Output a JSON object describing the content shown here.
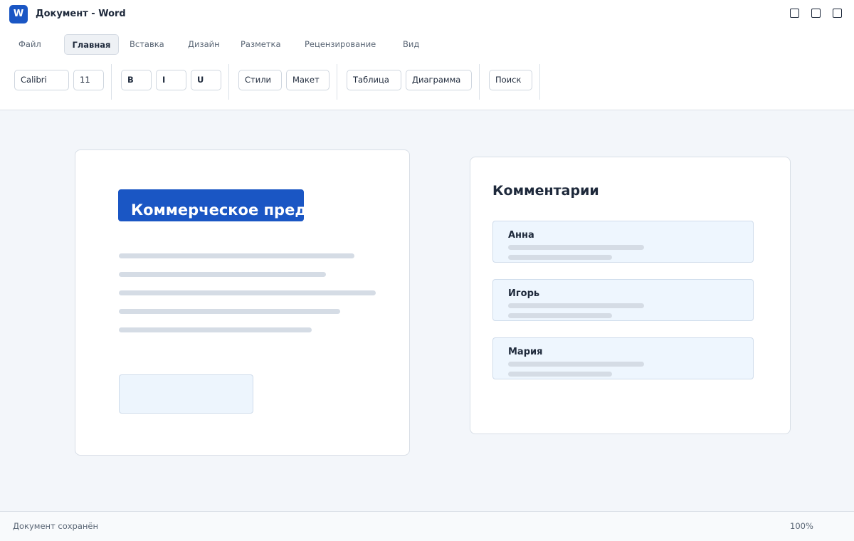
{
  "window": {
    "logo": "W",
    "title": "Документ - Word",
    "controls": [
      "minimize-icon",
      "maximize-icon",
      "close-icon"
    ]
  },
  "ribbon": {
    "tabs": [
      {
        "label": "Файл",
        "active": false
      },
      {
        "label": "Главная",
        "active": true
      },
      {
        "label": "Вставка",
        "active": false
      },
      {
        "label": "Дизайн",
        "active": false
      },
      {
        "label": "Разметка",
        "active": false
      },
      {
        "label": "Рецензирование",
        "active": false
      },
      {
        "label": "Вид",
        "active": false
      }
    ],
    "font_name": "Calibri",
    "font_size": "11",
    "bold_label": "B",
    "italic_label": "I",
    "underline_label": "U",
    "styles_label": "Стили",
    "layout_label": "Макет",
    "table_label": "Таблица",
    "chart_label": "Диаграмма",
    "search_label": "Поиск"
  },
  "document": {
    "heading": "Коммерческое предложение"
  },
  "comments": {
    "title": "Комментарии",
    "items": [
      {
        "author": "Анна"
      },
      {
        "author": "Игорь"
      },
      {
        "author": "Мария"
      }
    ]
  },
  "status": {
    "text": "Документ сохранён",
    "zoom": "100%"
  },
  "colors": {
    "accent": "#1a56c4",
    "background": "#f3f6fa",
    "placeholder_line": "#d5dce5",
    "comment_bg": "#eef6fe"
  }
}
